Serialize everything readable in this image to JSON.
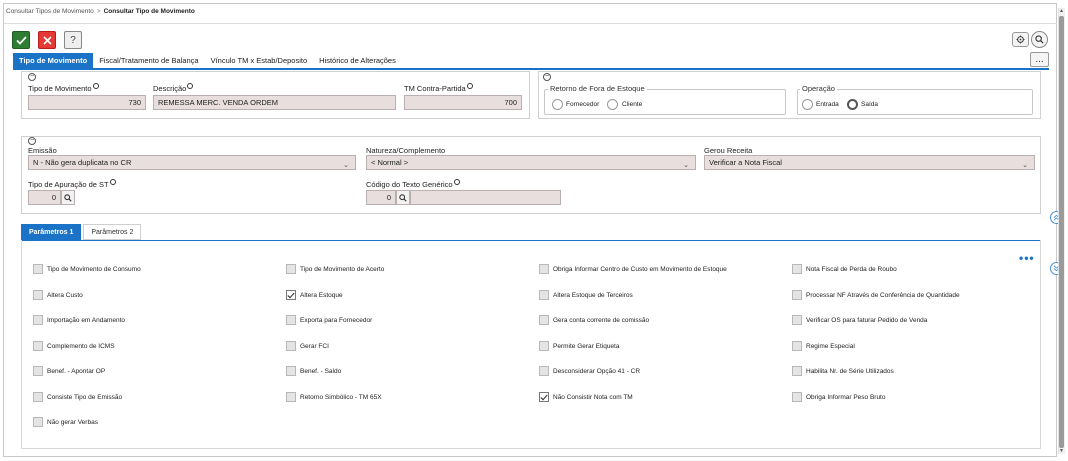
{
  "breadcrumb": {
    "parent": "Consultar Tipos de Movimento",
    "separator": ">",
    "current": "Consultar Tipo de Movimento"
  },
  "toolbar": {
    "ok_icon": "check-icon",
    "cancel_icon": "close-icon",
    "help_label": "?",
    "settings_icon": "gear-icon",
    "zoom_icon": "search-icon",
    "more_label": "..."
  },
  "tabs": [
    {
      "label": "Tipo de Movimento",
      "active": true
    },
    {
      "label": "Fiscal/Tratamento de Balança",
      "active": false
    },
    {
      "label": "Vínculo TM x Estab/Deposito",
      "active": false
    },
    {
      "label": "Histórico de Alterações",
      "active": false
    }
  ],
  "group1": {
    "collapse_label": "−",
    "tipo_movimento": {
      "label": "Tipo de Movimento",
      "value": "730"
    },
    "descricao": {
      "label": "Descrição",
      "value": "REMESSA MERC. VENDA ORDEM"
    },
    "tm_contra": {
      "label": "TM Contra-Partida",
      "value": "700"
    }
  },
  "group2": {
    "collapse_label": "−",
    "retorno": {
      "legend": "Retorno de Fora de Estoque",
      "options": [
        "Fornecedor",
        "Cliente"
      ],
      "selected": null
    },
    "operacao": {
      "legend": "Operação",
      "options": [
        "Entrada",
        "Saída"
      ],
      "selected": "Saída"
    }
  },
  "group3": {
    "collapse_label": "−",
    "emissao": {
      "label": "Emissão",
      "value": "N - Não gera duplicata no CR"
    },
    "natureza": {
      "label": "Natureza/Complemento",
      "value": "< Normal >"
    },
    "gerou_receita": {
      "label": "Gerou Receita",
      "value": "Verificar a Nota Fiscal"
    },
    "tipo_apuracao": {
      "label": "Tipo de Apuração de ST",
      "value": "0"
    },
    "codigo_texto": {
      "label": "Código do Texto Genérico",
      "value": "0",
      "description": ""
    }
  },
  "param_tabs": [
    {
      "label": "Parâmetros 1",
      "active": true
    },
    {
      "label": "Parâmetros 2",
      "active": false
    }
  ],
  "params_more": "•••",
  "params": [
    [
      {
        "label": "Tipo de Movimento de Consumo",
        "checked": false
      },
      {
        "label": "Altera Custo",
        "checked": false
      },
      {
        "label": "Importação em Andamento",
        "checked": false
      },
      {
        "label": "Complemento de ICMS",
        "checked": false
      },
      {
        "label": "Benef. - Apontar OP",
        "checked": false
      },
      {
        "label": "Consiste Tipo de Emissão",
        "checked": false
      },
      {
        "label": "Não gerar Verbas",
        "checked": false
      }
    ],
    [
      {
        "label": "Tipo de Movimento de Acerto",
        "checked": false
      },
      {
        "label": "Altera Estoque",
        "checked": true
      },
      {
        "label": "Exporta para Fornecedor",
        "checked": false
      },
      {
        "label": "Gerar FCI",
        "checked": false
      },
      {
        "label": "Benef. - Saldo",
        "checked": false
      },
      {
        "label": "Retorno Simbólico - TM 65X",
        "checked": false
      }
    ],
    [
      {
        "label": "Obriga Informar Centro de Custo em Movimento de Estoque",
        "checked": false
      },
      {
        "label": "Altera Estoque de Terceiros",
        "checked": false
      },
      {
        "label": "Gera conta corrente de comissão",
        "checked": false
      },
      {
        "label": "Permite Gerar Etiqueta",
        "checked": false
      },
      {
        "label": "Desconsiderar Opção 41 - CR",
        "checked": false
      },
      {
        "label": "Não Consistir Nota com TM",
        "checked": true
      }
    ],
    [
      {
        "label": "Nota Fiscal de Perda de Roubo",
        "checked": false
      },
      {
        "label": "Processar NF Através de Conferência de Quantidade",
        "checked": false
      },
      {
        "label": "Verificar OS para faturar Pedido de Venda",
        "checked": false
      },
      {
        "label": "Regime Especial",
        "checked": false
      },
      {
        "label": "Habilita Nr. de Série Utilizados",
        "checked": false
      },
      {
        "label": "Obriga Informar Peso Bruto",
        "checked": false
      }
    ]
  ],
  "colors": {
    "accent": "#1a73c7",
    "ok": "#2e7d32",
    "cancel": "#e53935",
    "field_bg": "#e8dede"
  }
}
